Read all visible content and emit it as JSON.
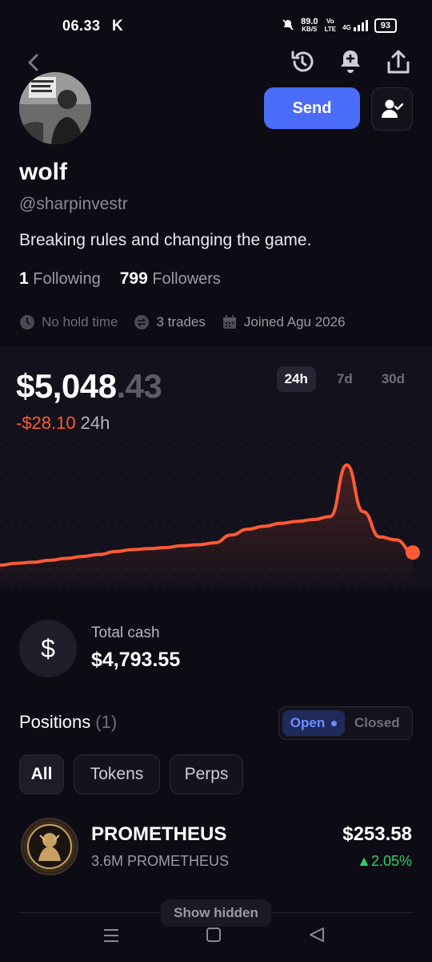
{
  "status_bar": {
    "time": "06.33",
    "app_glyph": "K",
    "speed_value": "89.0",
    "speed_unit": "KB/S",
    "network_top": "Vo",
    "network_bottom": "LTE",
    "signal_label": "4G",
    "battery": "93"
  },
  "profile": {
    "name": "wolf",
    "handle": "@sharpinvestr",
    "bio": "Breaking rules and changing the game.",
    "following_count": "1",
    "following_label": "Following",
    "followers_count": "799",
    "followers_label": "Followers",
    "hold_time": "No hold time",
    "trades": "3 trades",
    "joined": "Joined Agu 2026"
  },
  "actions": {
    "send_label": "Send"
  },
  "portfolio": {
    "value_main": "$5,048",
    "value_decimal": ".43",
    "change_value": "-$28.10",
    "change_period": "24h",
    "tabs": [
      "24h",
      "7d",
      "30d"
    ],
    "active_tab": "24h"
  },
  "chart_data": {
    "type": "line",
    "title": "",
    "xlabel": "",
    "ylabel": "",
    "series": [
      {
        "values": [
          5035,
          5037,
          5038,
          5040,
          5042,
          5044,
          5046,
          5049,
          5051,
          5052,
          5053,
          5055,
          5056,
          5058,
          5066,
          5072,
          5075,
          5078,
          5080,
          5082,
          5085,
          5138,
          5090,
          5064,
          5061,
          5048
        ]
      }
    ],
    "color": "#ff5a35"
  },
  "cash": {
    "icon": "dollar-icon",
    "symbol": "$",
    "label": "Total cash",
    "value": "$4,793.55"
  },
  "positions": {
    "title": "Positions",
    "count": "(1)",
    "toggle_open": "Open",
    "toggle_closed": "Closed",
    "filters": [
      "All",
      "Tokens",
      "Perps"
    ],
    "items": [
      {
        "name": "PROMETHEUS",
        "amount": "3.6M PROMETHEUS",
        "price": "$253.58",
        "change": "▲2.05%"
      }
    ],
    "show_hidden_label": "Show hidden"
  },
  "colors": {
    "background": "#0d0c14",
    "accent": "#4a6cf7",
    "negative": "#ff5a35",
    "positive": "#2fcf6a"
  }
}
